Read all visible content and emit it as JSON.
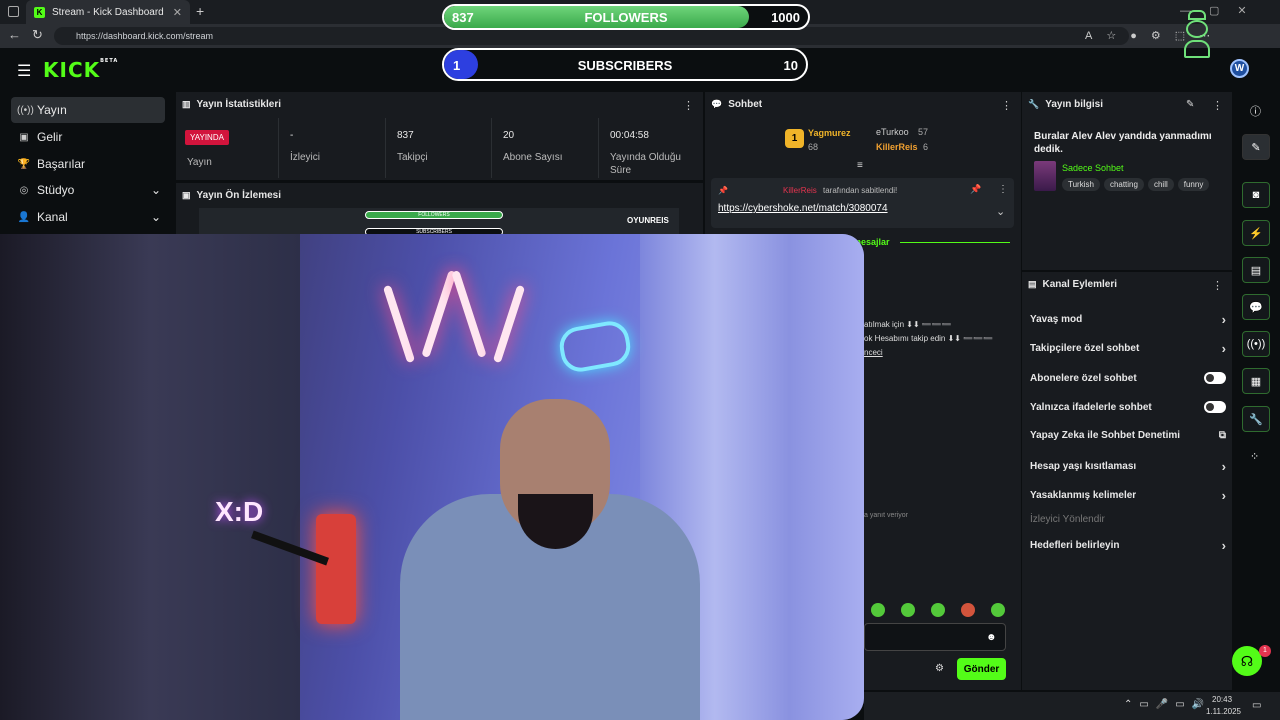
{
  "browser": {
    "tab_title": "Stream - Kick Dashboard",
    "url": "https://dashboard.kick.com/stream",
    "new_tab": "+",
    "close": "✕"
  },
  "overlay": {
    "followers_current": "837",
    "followers_label": "FOLLOWERS",
    "followers_goal": "1000",
    "followers_progress": 0.837,
    "subs_current": "1",
    "subs_label": "SUBSCRIBERS",
    "subs_goal": "10",
    "subs_progress": 0.1
  },
  "header": {
    "logo": "KICK",
    "logo_badge": "BETA",
    "avatar_letter": "W"
  },
  "sidebar": {
    "items": [
      {
        "label": "Yayın",
        "icon": "((•))"
      },
      {
        "label": "Gelir",
        "icon": "▣"
      },
      {
        "label": "Başarılar",
        "icon": "🏆"
      },
      {
        "label": "Stüdyo",
        "icon": "◎"
      },
      {
        "label": "Kanal",
        "icon": "👤"
      }
    ]
  },
  "stats": {
    "title": "Yayın İstatistikleri",
    "live_badge": "YAYINDA",
    "columns": [
      {
        "value": "",
        "label": "Yayın"
      },
      {
        "value": "-",
        "label": "İzleyici"
      },
      {
        "value": "837",
        "label": "Takipçi"
      },
      {
        "value": "20",
        "label": "Abone Sayısı"
      },
      {
        "value": "00:04:58",
        "label": "Yayında Olduğu Süre"
      }
    ]
  },
  "preview": {
    "title": "Yayın Ön İzlemesi",
    "mini_followers": "FOLLOWERS",
    "mini_subs": "SUBSCRIBERS",
    "mini_brand": "OYUNREIS"
  },
  "chat": {
    "title": "Sohbet",
    "leaders": [
      {
        "rank": "1",
        "name": "Yagmurez",
        "count": "68"
      },
      {
        "rank": "",
        "name": "eTurkoo",
        "count": "57"
      },
      {
        "rank": "",
        "name": "KillerReis",
        "count": "6"
      }
    ],
    "pinned_by_user": "KillerReis",
    "pinned_by_text": "tarafından sabitlendi!",
    "pinned_link": "https://cybershoke.net/match/3080074",
    "section_label": "i mesajlar",
    "line1": "atılmak için ⬇⬇ ➖➖➖",
    "line2": "ok Hesabımı takip edin ⬇⬇ ➖➖➖",
    "line3": "nceci",
    "reply_note": "a yanıt veriyor",
    "send_label": "Gönder"
  },
  "info": {
    "title": "Yayın bilgisi",
    "stream_title": "Buralar Alev Alev yandıda yanmadımı dedik.",
    "category": "Sadece Sohbet",
    "tags": [
      "Turkish",
      "chatting",
      "chill",
      "funny"
    ]
  },
  "actions": {
    "title": "Kanal Eylemleri",
    "items": [
      {
        "label": "Yavaş mod",
        "control": "arrow"
      },
      {
        "label": "Takipçilere özel sohbet",
        "control": "arrow"
      },
      {
        "label": "Abonelere özel sohbet",
        "control": "toggle"
      },
      {
        "label": "Yalnızca ifadelerle sohbet",
        "control": "toggle"
      },
      {
        "label": "Yapay Zeka ile Sohbet Denetimi",
        "control": "external"
      },
      {
        "label": "Hesap yaşı kısıtlaması",
        "control": "arrow"
      },
      {
        "label": "Yasaklanmış kelimeler",
        "control": "arrow"
      },
      {
        "label": "İzleyici Yönlendir",
        "control": "none"
      },
      {
        "label": "Hedefleri belirleyin",
        "control": "arrow"
      }
    ]
  },
  "taskbar": {
    "time": "20:43",
    "date": "1.11.2025"
  },
  "help_badge": "1",
  "colors": {
    "brand": "#53fc18",
    "live": "#d2143c",
    "sub_fill": "#2d3fe0"
  }
}
